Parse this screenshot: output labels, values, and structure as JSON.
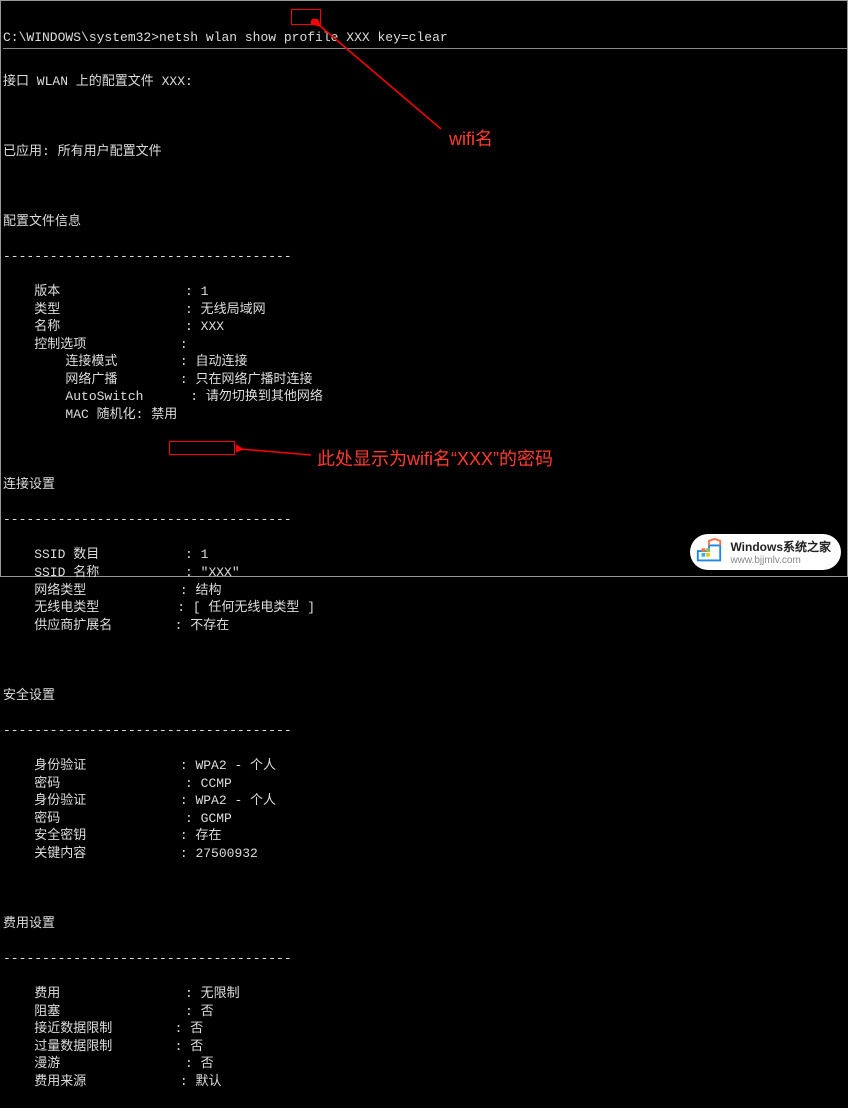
{
  "prompt": {
    "path": "C:\\WINDOWS\\system32>",
    "command_pre": "netsh wlan show profile ",
    "command_profile": "XXX",
    "command_post": " key=clear"
  },
  "section_interface": "接口 WLAN 上的配置文件 XXX:",
  "line_applied": "已应用: 所有用户配置文件",
  "sections": {
    "profile_info": "配置文件信息",
    "connection": "连接设置",
    "security": "安全设置",
    "cost": "费用设置"
  },
  "dashes": "-------------------------------------",
  "profile_rows": [
    {
      "label": "版本",
      "value": "1"
    },
    {
      "label": "类型",
      "value": "无线局域网"
    },
    {
      "label": "名称",
      "value": "XXX"
    },
    {
      "label": "控制选项",
      "value": ""
    },
    {
      "label": "连接模式",
      "value": "自动连接",
      "indent": true
    },
    {
      "label": "网络广播",
      "value": "只在网络广播时连接",
      "indent": true
    },
    {
      "label": "AutoSwitch",
      "value": "请勿切换到其他网络",
      "indent": true
    },
    {
      "label": "MAC 随机化: 禁用",
      "value": "",
      "indent": true
    }
  ],
  "connection_rows": [
    {
      "label": "SSID 数目",
      "value": "1"
    },
    {
      "label": "SSID 名称",
      "value": "\"XXX\""
    },
    {
      "label": "网络类型",
      "value": "结构"
    },
    {
      "label": "无线电类型",
      "value": "[ 任何无线电类型 ]"
    },
    {
      "label": "供应商扩展名",
      "value": "不存在"
    }
  ],
  "security_rows": [
    {
      "label": "身份验证",
      "value": "WPA2 - 个人"
    },
    {
      "label": "密码",
      "value": "CCMP"
    },
    {
      "label": "身份验证",
      "value": "WPA2 - 个人"
    },
    {
      "label": "密码",
      "value": "GCMP"
    },
    {
      "label": "安全密钥",
      "value": "存在"
    },
    {
      "label": "关键内容",
      "value": "27500932"
    }
  ],
  "cost_rows": [
    {
      "label": "费用",
      "value": "无限制"
    },
    {
      "label": "阻塞",
      "value": "否"
    },
    {
      "label": "接近数据限制",
      "value": "否"
    },
    {
      "label": "过量数据限制",
      "value": "否"
    },
    {
      "label": "漫游",
      "value": "否"
    },
    {
      "label": "费用来源",
      "value": "默认"
    }
  ],
  "annotations": {
    "wifi_name": "wifi名",
    "password_note": "此处显示为wifi名“XXX”的密码"
  },
  "watermark": {
    "title": "Windows系统之家",
    "url": "www.bjjmlv.com"
  }
}
